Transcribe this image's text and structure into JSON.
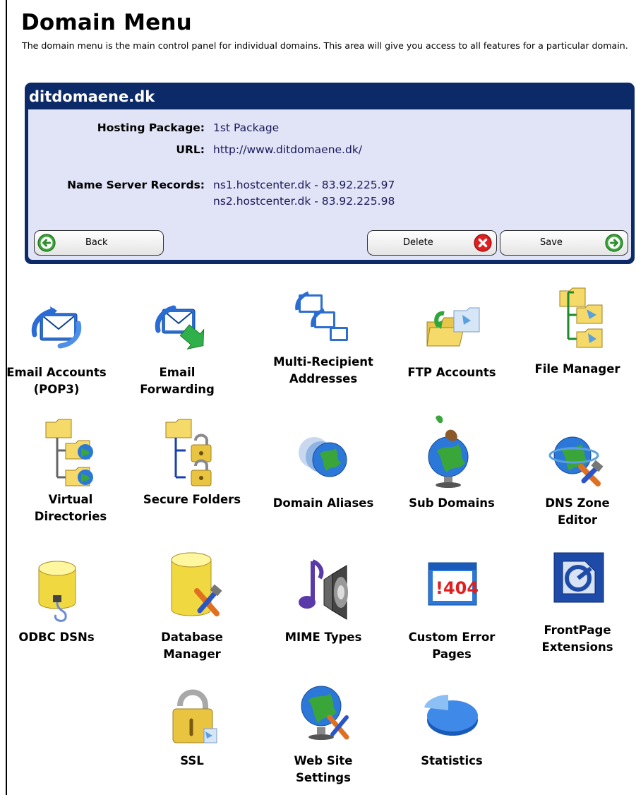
{
  "header": {
    "title": "Domain Menu",
    "description": "The domain menu is the main control panel for individual domains. This area will give you access to all features for a particular domain."
  },
  "domain_panel": {
    "domain_name": "ditdomaene.dk",
    "hosting_package_label": "Hosting Package:",
    "hosting_package_value": "1st Package",
    "url_label": "URL:",
    "url_value": "http://www.ditdomaene.dk/",
    "nameservers_label": "Name Server Records:",
    "nameserver_1": "ns1.hostcenter.dk - 83.92.225.97",
    "nameserver_2": "ns2.hostcenter.dk - 83.92.225.98",
    "back_label": "Back",
    "delete_label": "Delete",
    "save_label": "Save"
  },
  "features": [
    {
      "label": "Email Accounts\n(POP3)",
      "icon": "email-accounts-icon"
    },
    {
      "label": "Email\nForwarding",
      "icon": "email-forwarding-icon"
    },
    {
      "label": "Multi-Recipient\nAddresses",
      "icon": "multi-recipient-icon"
    },
    {
      "label": "FTP Accounts",
      "icon": "ftp-folder-icon"
    },
    {
      "label": "File Manager",
      "icon": "file-manager-icon"
    },
    {
      "label": "Virtual\nDirectories",
      "icon": "virtual-directories-icon"
    },
    {
      "label": "Secure Folders",
      "icon": "secure-folders-icon"
    },
    {
      "label": "Domain Aliases",
      "icon": "domain-aliases-icon"
    },
    {
      "label": "Sub Domains",
      "icon": "sub-domains-icon"
    },
    {
      "label": "DNS Zone\nEditor",
      "icon": "dns-zone-icon"
    },
    {
      "label": "ODBC DSNs",
      "icon": "odbc-icon"
    },
    {
      "label": "Database\nManager",
      "icon": "database-manager-icon"
    },
    {
      "label": "MIME Types",
      "icon": "mime-types-icon"
    },
    {
      "label": "Custom Error\nPages",
      "icon": "custom-error-icon"
    },
    {
      "label": "FrontPage\nExtensions",
      "icon": "frontpage-icon"
    },
    {
      "label": "SSL",
      "icon": "ssl-lock-icon"
    },
    {
      "label": "Web Site\nSettings",
      "icon": "website-settings-icon"
    },
    {
      "label": "Statistics",
      "icon": "statistics-icon"
    }
  ],
  "error_icon_text": "!404",
  "colors": {
    "panel_bg": "#0d2a68",
    "panel_body": "#e1e3f6",
    "button_green": "#3aa63a",
    "button_red": "#e02020"
  }
}
